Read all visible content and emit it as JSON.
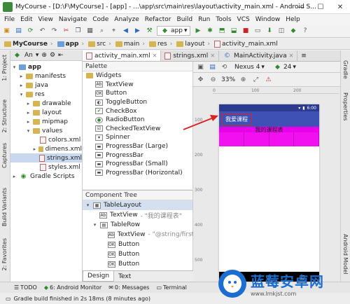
{
  "window": {
    "title": "MyCourse - [D:\\F\\MyCourse] - [app] - ...\\app\\src\\main\\res\\layout\\activity_main.xml - Android S...",
    "min": "—",
    "max": "☐",
    "close": "✕"
  },
  "menu": [
    "File",
    "Edit",
    "View",
    "Navigate",
    "Code",
    "Analyze",
    "Refactor",
    "Build",
    "Run",
    "Tools",
    "VCS",
    "Window",
    "Help"
  ],
  "toolbar": {
    "run_config": "app"
  },
  "breadcrumbs": [
    "MyCourse",
    "app",
    "src",
    "main",
    "res",
    "layout",
    "activity_main.xml"
  ],
  "project": {
    "view_selector": "An",
    "tree": [
      {
        "label": "app",
        "level": 0,
        "expanded": true
      },
      {
        "label": "manifests",
        "level": 1
      },
      {
        "label": "java",
        "level": 1
      },
      {
        "label": "res",
        "level": 1,
        "expanded": true
      },
      {
        "label": "drawable",
        "level": 2
      },
      {
        "label": "layout",
        "level": 2
      },
      {
        "label": "mipmap",
        "level": 2
      },
      {
        "label": "values",
        "level": 2,
        "expanded": true
      },
      {
        "label": "colors.xml",
        "level": 3
      },
      {
        "label": "dimens.xml",
        "level": 3
      },
      {
        "label": "strings.xml",
        "level": 3,
        "selected": true
      },
      {
        "label": "styles.xml",
        "level": 3
      },
      {
        "label": "Gradle Scripts",
        "level": 0
      }
    ]
  },
  "editor_tabs": [
    {
      "label": "activity_main.xml",
      "active": true
    },
    {
      "label": "strings.xml"
    },
    {
      "label": "MainActivity.java"
    }
  ],
  "palette": {
    "header": "Palette",
    "group": "Widgets",
    "items": [
      "TextView",
      "Button",
      "ToggleButton",
      "CheckBox",
      "RadioButton",
      "CheckedTextView",
      "Spinner",
      "ProgressBar (Large)",
      "ProgressBar",
      "ProgressBar (Small)",
      "ProgressBar (Horizontal)"
    ]
  },
  "component_tree": {
    "header": "Component Tree",
    "items": [
      {
        "label": "TableLayout",
        "hint": "",
        "level": 0
      },
      {
        "label": "TextView",
        "hint": " - \"我的课程表\"",
        "level": 1
      },
      {
        "label": "TableRow",
        "hint": "",
        "level": 1
      },
      {
        "label": "TextView",
        "hint": " - \"@string/first\"",
        "level": 2
      },
      {
        "label": "Button",
        "hint": "",
        "level": 2
      },
      {
        "label": "Button",
        "hint": "",
        "level": 2
      },
      {
        "label": "Button",
        "hint": "",
        "level": 2
      }
    ]
  },
  "design_tabs": {
    "design": "Design",
    "text": "Text"
  },
  "editor_toolbar": {
    "device": "Nexus 4",
    "api": "24",
    "zoom": "33%"
  },
  "ruler": {
    "top": [
      "0",
      "100",
      "200"
    ],
    "left": [
      "100",
      "200",
      "300",
      "400",
      "500"
    ]
  },
  "phone": {
    "time": "6:00",
    "app_title": "我爱课程",
    "header_text": "我的课程表"
  },
  "left_strip": [
    "1: Project",
    "2: Structure",
    "Captures",
    "Build Variants",
    "2: Favorites"
  ],
  "right_strip": [
    "Gradle",
    "Properties",
    "Android Model"
  ],
  "bottom_tools": [
    "TODO",
    "6: Android Monitor",
    "0: Messages",
    "Terminal"
  ],
  "status": "Gradle build finished in 2s 18ms (8 minutes ago)",
  "watermark": {
    "title": "蓝莓安卓网",
    "url": "www.lmkjst.com"
  },
  "colors": {
    "appbar": "#3f51b5",
    "statusbar": "#2c3b8f",
    "magenta": "#e800e8",
    "annotation": "#e02020"
  }
}
